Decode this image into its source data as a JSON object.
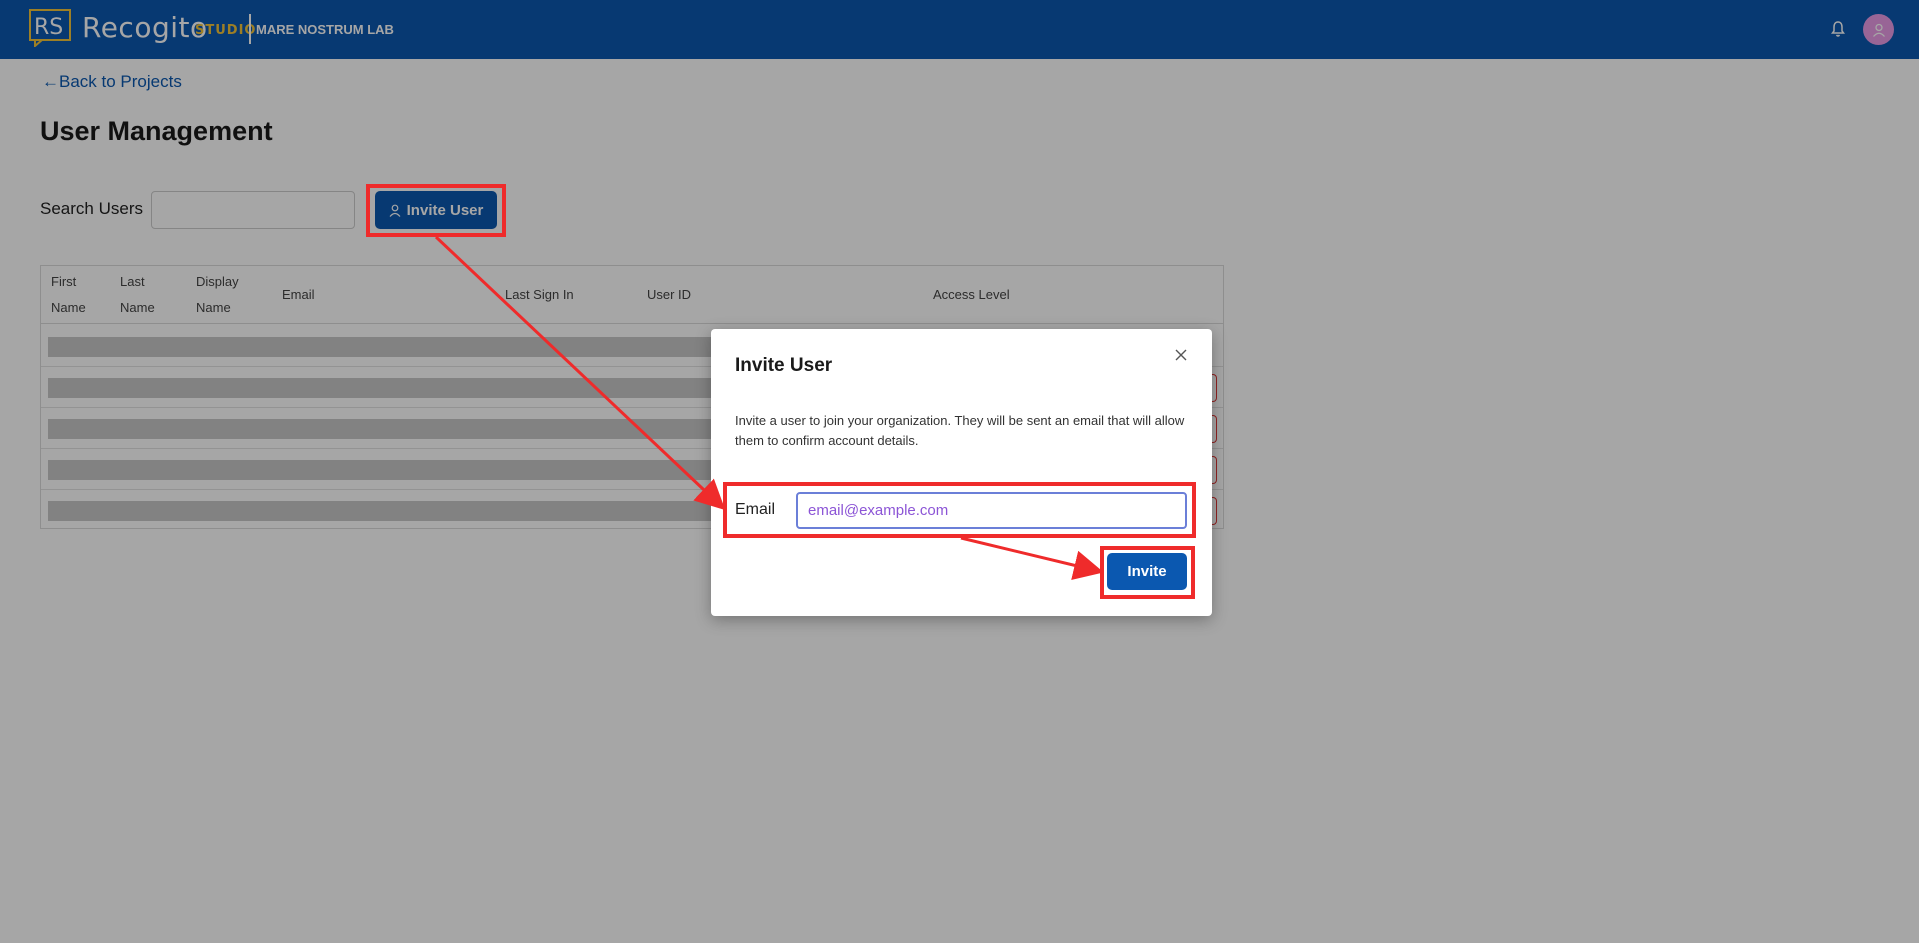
{
  "header": {
    "brand_name": "Recogito",
    "brand_logo_text": "RS",
    "brand_sub": "STUDIO",
    "org_name": "MARE NOSTRUM LAB",
    "bell_icon": "bell-icon",
    "avatar_icon": "user-icon",
    "color": "#0b58b0"
  },
  "nav": {
    "back_label": "←Back to Projects"
  },
  "page": {
    "title": "User Management",
    "search_label": "Search Users",
    "search_placeholder": "",
    "invite_user_label": "Invite User"
  },
  "table": {
    "headers": {
      "first_name_1": "First",
      "first_name_2": "Name",
      "last_name_1": "Last",
      "last_name_2": "Name",
      "display_name_1": "Display",
      "display_name_2": "Name",
      "email": "Email",
      "last_sign_in": "Last Sign In",
      "user_id": "User ID",
      "access_level": "Access Level"
    },
    "loading_rows": 5
  },
  "modal": {
    "title": "Invite User",
    "description": "Invite a user to join your organization. They will be sent an email that will allow them to confirm account details.",
    "email_label": "Email",
    "email_placeholder": "email@example.com",
    "submit_label": "Invite"
  },
  "annotation_color": "#ef2b2b"
}
